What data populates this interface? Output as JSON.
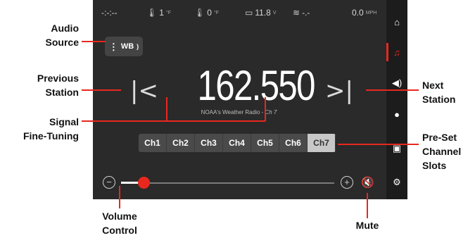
{
  "status_bar": {
    "signal": "-:-:--",
    "temp1_value": "1",
    "temp1_unit": "°F",
    "temp2_value": "0",
    "temp2_unit": "°F",
    "battery_value": "11.8",
    "battery_unit": "V",
    "wind_value": "-.-",
    "speed_value": "0.0",
    "speed_unit": "MPH"
  },
  "audio_source": {
    "label": "WB"
  },
  "radio": {
    "frequency": "162.550",
    "station_name": "NOAA's Weather Radio - ",
    "station_channel": "Ch 7"
  },
  "presets": [
    "Ch1",
    "Ch2",
    "Ch3",
    "Ch4",
    "Ch5",
    "Ch6",
    "Ch7"
  ],
  "active_preset": "Ch7",
  "volume": {
    "level": 0.08
  },
  "callouts": {
    "audio_source": "Audio\nSource",
    "previous_station": "Previous\nStation",
    "signal_fine_tuning": "Signal\nFine-Tuning",
    "volume_control": "Volume\nControl",
    "next_station": "Next\nStation",
    "preset_slots": "Pre-Set\nChannel\nSlots",
    "mute": "Mute"
  },
  "colors": {
    "accent": "#e8281e",
    "screen_bg": "#2a2a2a",
    "sidebar_bg": "#1c1c1c"
  },
  "icons": {
    "sidebar": [
      "home-icon",
      "music-icon",
      "speaker-icon",
      "light-icon",
      "camera-icon",
      "settings-icon"
    ]
  }
}
